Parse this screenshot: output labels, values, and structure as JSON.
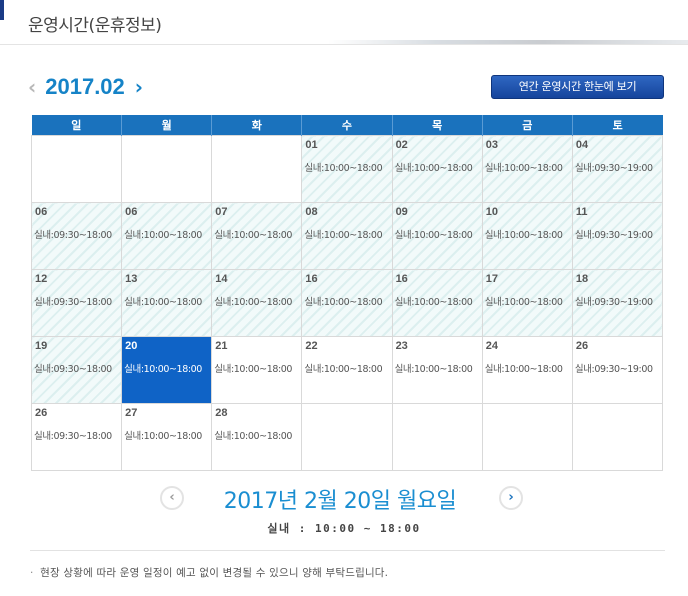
{
  "header": {
    "title": "운영시간(운휴정보)"
  },
  "month_nav": {
    "prev": "‹",
    "month": "2017.02",
    "next": "›"
  },
  "annual_button": "연간 운영시간 한눈에 보기",
  "weekdays": [
    "일",
    "월",
    "화",
    "수",
    "목",
    "금",
    "토"
  ],
  "weeks": [
    [
      {
        "day": "",
        "hours": ""
      },
      {
        "day": "",
        "hours": ""
      },
      {
        "day": "",
        "hours": ""
      },
      {
        "day": "01",
        "hours": "실내:10:00~18:00",
        "stripe": true
      },
      {
        "day": "02",
        "hours": "실내:10:00~18:00",
        "stripe": true
      },
      {
        "day": "03",
        "hours": "실내:10:00~18:00",
        "stripe": true
      },
      {
        "day": "04",
        "hours": "실내:09:30~19:00",
        "stripe": true
      }
    ],
    [
      {
        "day": "06",
        "hours": "실내:09:30~18:00",
        "stripe": true
      },
      {
        "day": "06",
        "hours": "실내:10:00~18:00",
        "stripe": true
      },
      {
        "day": "07",
        "hours": "실내:10:00~18:00",
        "stripe": true
      },
      {
        "day": "08",
        "hours": "실내:10:00~18:00",
        "stripe": true
      },
      {
        "day": "09",
        "hours": "실내:10:00~18:00",
        "stripe": true
      },
      {
        "day": "10",
        "hours": "실내:10:00~18:00",
        "stripe": true
      },
      {
        "day": "11",
        "hours": "실내:09:30~19:00",
        "stripe": true
      }
    ],
    [
      {
        "day": "12",
        "hours": "실내:09:30~18:00",
        "stripe": true
      },
      {
        "day": "13",
        "hours": "실내:10:00~18:00",
        "stripe": true
      },
      {
        "day": "14",
        "hours": "실내:10:00~18:00",
        "stripe": true
      },
      {
        "day": "16",
        "hours": "실내:10:00~18:00",
        "stripe": true
      },
      {
        "day": "16",
        "hours": "실내:10:00~18:00",
        "stripe": true
      },
      {
        "day": "17",
        "hours": "실내:10:00~18:00",
        "stripe": true
      },
      {
        "day": "18",
        "hours": "실내:09:30~19:00",
        "stripe": true
      }
    ],
    [
      {
        "day": "19",
        "hours": "실내:09:30~18:00",
        "stripe": true
      },
      {
        "day": "20",
        "hours": "실내:10:00~18:00",
        "selected": true
      },
      {
        "day": "21",
        "hours": "실내:10:00~18:00"
      },
      {
        "day": "22",
        "hours": "실내:10:00~18:00"
      },
      {
        "day": "23",
        "hours": "실내:10:00~18:00"
      },
      {
        "day": "24",
        "hours": "실내:10:00~18:00"
      },
      {
        "day": "26",
        "hours": "실내:09:30~19:00"
      }
    ],
    [
      {
        "day": "26",
        "hours": "실내:09:30~18:00"
      },
      {
        "day": "27",
        "hours": "실내:10:00~18:00"
      },
      {
        "day": "28",
        "hours": "실내:10:00~18:00"
      },
      {
        "day": "",
        "hours": ""
      },
      {
        "day": "",
        "hours": ""
      },
      {
        "day": "",
        "hours": ""
      },
      {
        "day": "",
        "hours": ""
      }
    ]
  ],
  "date_nav": {
    "prev": "‹",
    "next": "›",
    "selected_date": "2017년 2월 20일 월요일"
  },
  "selected_hours": "실내 : 10:00 ~ 18:00",
  "notice": {
    "bullet": "·",
    "text": "현장 상황에 따라 운영 일정이 예고 없이 변경될 수 있으니 양해 부탁드립니다."
  },
  "colors": {
    "accent": "#1583c7",
    "header_bar": "#1a72bd",
    "selected": "#0f63c6"
  }
}
